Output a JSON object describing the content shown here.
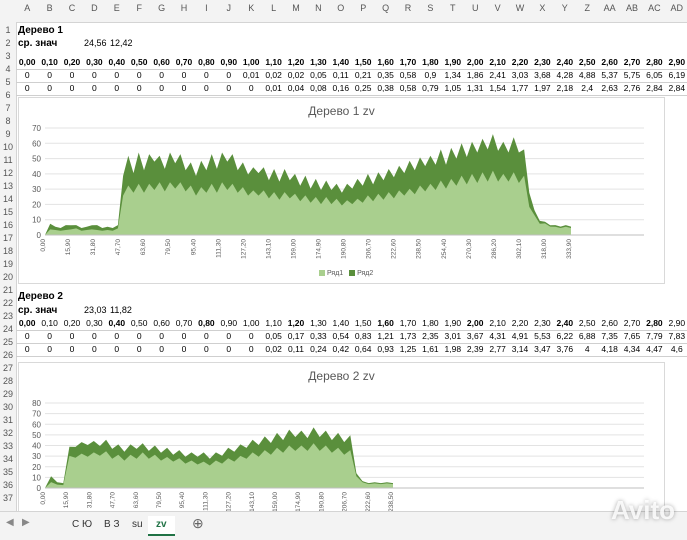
{
  "columns": [
    "A",
    "B",
    "C",
    "D",
    "E",
    "F",
    "G",
    "H",
    "I",
    "J",
    "K",
    "L",
    "M",
    "N",
    "O",
    "P",
    "Q",
    "R",
    "S",
    "T",
    "U",
    "V",
    "W",
    "X",
    "Y",
    "Z",
    "AA",
    "AB",
    "AC",
    "AD"
  ],
  "rows": [
    "1",
    "2",
    "3",
    "4",
    "5",
    "6",
    "7",
    "8",
    "9",
    "10",
    "11",
    "12",
    "13",
    "14",
    "15",
    "16",
    "17",
    "18",
    "19",
    "20",
    "21",
    "22",
    "23",
    "24",
    "25",
    "26",
    "27",
    "28",
    "29",
    "30",
    "31",
    "32",
    "33",
    "34",
    "35",
    "36",
    "37"
  ],
  "section1": {
    "title": "Дерево 1",
    "avg_label": "ср. знач",
    "avg1": "24,56",
    "avg2": "12,42",
    "row3": [
      "0,00",
      "0,10",
      "0,20",
      "0,30",
      "0,40",
      "0,50",
      "0,60",
      "0,70",
      "0,80",
      "0,90",
      "1,00",
      "1,10",
      "1,20",
      "1,30",
      "1,40",
      "1,50",
      "1,60",
      "1,70",
      "1,80",
      "1,90",
      "2,00",
      "2,10",
      "2,20",
      "2,30",
      "2,40",
      "2,50",
      "2,60",
      "2,70",
      "2,80",
      "2,90"
    ],
    "row4": [
      "0",
      "0",
      "0",
      "0",
      "0",
      "0",
      "0",
      "0",
      "0",
      "0",
      "0,01",
      "0,02",
      "0,02",
      "0,05",
      "0,11",
      "0,21",
      "0,35",
      "0,58",
      "0,9",
      "1,34",
      "1,86",
      "2,41",
      "3,03",
      "3,68",
      "4,28",
      "4,88",
      "5,37",
      "5,75",
      "6,05",
      "6,19"
    ],
    "row5": [
      "0",
      "0",
      "0",
      "0",
      "0",
      "0",
      "0",
      "0",
      "0",
      "0",
      "0",
      "0,01",
      "0,04",
      "0,08",
      "0,16",
      "0,25",
      "0,38",
      "0,58",
      "0,79",
      "1,05",
      "1,31",
      "1,54",
      "1,77",
      "1,97",
      "2,18",
      "2,4",
      "2,63",
      "2,76",
      "2,84",
      "2,84"
    ]
  },
  "section2": {
    "title": "Дерево 2",
    "avg_label": "ср. знач",
    "avg1": "23,03",
    "avg2": "11,82",
    "row23": [
      "0,00",
      "0,10",
      "0,20",
      "0,30",
      "0,40",
      "0,50",
      "0,60",
      "0,70",
      "0,80",
      "0,90",
      "1,00",
      "1,10",
      "1,20",
      "1,30",
      "1,40",
      "1,50",
      "1,60",
      "1,70",
      "1,80",
      "1,90",
      "2,00",
      "2,10",
      "2,20",
      "2,30",
      "2,40",
      "2,50",
      "2,60",
      "2,70",
      "2,80",
      "2,90"
    ],
    "row24": [
      "0",
      "0",
      "0",
      "0",
      "0",
      "0",
      "0",
      "0",
      "0",
      "0",
      "0",
      "0,05",
      "0,17",
      "0,33",
      "0,54",
      "0,83",
      "1,21",
      "1,73",
      "2,35",
      "3,01",
      "3,67",
      "4,31",
      "4,91",
      "5,53",
      "6,22",
      "6,88",
      "7,35",
      "7,65",
      "7,79",
      "7,83"
    ],
    "row25": [
      "0",
      "0",
      "0",
      "0",
      "0",
      "0",
      "0",
      "0",
      "0",
      "0",
      "0",
      "0,02",
      "0,11",
      "0,24",
      "0,42",
      "0,64",
      "0,93",
      "1,25",
      "1,61",
      "1,98",
      "2,39",
      "2,77",
      "3,14",
      "3,47",
      "3,76",
      "4",
      "4,18",
      "4,34",
      "4,47",
      "4,6"
    ]
  },
  "chart_data": [
    {
      "type": "area",
      "title": "Дерево 1 zv",
      "ylim": [
        0,
        70
      ],
      "yticks": [
        "70",
        "60",
        "50",
        "40",
        "30",
        "20",
        "10",
        "0"
      ],
      "xticks": [
        "0,00",
        "15,90",
        "31,80",
        "47,70",
        "63,60",
        "79,50",
        "95,40",
        "111,30",
        "127,20",
        "143,10",
        "159,00",
        "174,90",
        "190,80",
        "206,70",
        "222,60",
        "238,50",
        "254,40",
        "270,30",
        "286,20",
        "302,10",
        "318,00",
        "333,90"
      ],
      "x_start": 0,
      "x_end": 340,
      "legend": [
        "Ряд1",
        "Ряд2"
      ],
      "series": [
        {
          "name": "Ряд1",
          "color": "#a9cf8e",
          "values": [
            0,
            4,
            3,
            3,
            3,
            4,
            4,
            3,
            3,
            4,
            3,
            3,
            3,
            3,
            4,
            28,
            30,
            30,
            31,
            30,
            31,
            32,
            32,
            31,
            32,
            33,
            32,
            31,
            30,
            28,
            29,
            30,
            31,
            30,
            32,
            32,
            31,
            30,
            29,
            28,
            27,
            28,
            27,
            26,
            26,
            25,
            26,
            26,
            25,
            24,
            24,
            23,
            23,
            22,
            23,
            22,
            22,
            21,
            21,
            22,
            22,
            23,
            24,
            24,
            25,
            25,
            26,
            26,
            27,
            28,
            28,
            29,
            30,
            31,
            31,
            32,
            33,
            33,
            34,
            35,
            36,
            36,
            37,
            37,
            38,
            38,
            39,
            38,
            37,
            38,
            38,
            37,
            36,
            20,
            12,
            8,
            7,
            6,
            5,
            5,
            5,
            5
          ]
        },
        {
          "name": "Ryd2",
          "color": "#5a8f3c",
          "values": [
            0,
            8,
            5,
            5,
            6,
            7,
            6,
            5,
            5,
            7,
            6,
            5,
            5,
            5,
            6,
            42,
            48,
            44,
            50,
            46,
            49,
            52,
            48,
            47,
            50,
            51,
            49,
            46,
            44,
            42,
            45,
            46,
            49,
            47,
            50,
            52,
            49,
            46,
            44,
            43,
            41,
            44,
            41,
            39,
            40,
            38,
            40,
            39,
            37,
            35,
            36,
            33,
            34,
            32,
            33,
            32,
            31,
            30,
            31,
            33,
            34,
            35,
            37,
            36,
            38,
            39,
            40,
            41,
            42,
            44,
            45,
            46,
            47,
            49,
            48,
            50,
            52,
            50,
            53,
            54,
            56,
            55,
            57,
            58,
            59,
            60,
            62,
            59,
            57,
            58,
            60,
            58,
            52,
            30,
            15,
            10,
            8,
            7,
            6,
            6,
            6,
            6
          ]
        }
      ]
    },
    {
      "type": "area",
      "title": "Дерево 2 zv",
      "ylim": [
        0,
        80
      ],
      "yticks": [
        "80",
        "70",
        "60",
        "50",
        "40",
        "30",
        "20",
        "10",
        "0"
      ],
      "xticks": [
        "0,00",
        "15,90",
        "31,80",
        "47,70",
        "63,60",
        "79,50",
        "95,40",
        "111,30",
        "127,20",
        "143,10",
        "159,00",
        "174,90",
        "190,80",
        "206,70",
        "222,60",
        "238,50"
      ],
      "x_start": 0,
      "x_end": 240,
      "legend": [],
      "series": [
        {
          "name": "Ряд1",
          "color": "#a9cf8e",
          "values": [
            0,
            6,
            3,
            3,
            28,
            31,
            30,
            32,
            31,
            33,
            32,
            30,
            29,
            28,
            29,
            30,
            31,
            30,
            29,
            28,
            27,
            27,
            26,
            25,
            24,
            24,
            23,
            23,
            24,
            25,
            26,
            27,
            28,
            30,
            31,
            32,
            33,
            34,
            35,
            36,
            37,
            38,
            37,
            38,
            39,
            38,
            37,
            36,
            35,
            34,
            33,
            12,
            5,
            4,
            4,
            4,
            4,
            4
          ]
        },
        {
          "name": "Ryd2",
          "color": "#5a8f3c",
          "values": [
            0,
            12,
            5,
            5,
            36,
            42,
            40,
            44,
            41,
            43,
            42,
            40,
            38,
            37,
            38,
            40,
            39,
            38,
            37,
            36,
            35,
            34,
            33,
            32,
            31,
            32,
            31,
            30,
            31,
            33,
            35,
            37,
            38,
            41,
            42,
            44,
            45,
            46,
            48,
            49,
            51,
            52,
            50,
            51,
            53,
            52,
            50,
            49,
            48,
            47,
            46,
            15,
            6,
            5,
            5,
            5,
            5,
            5
          ]
        }
      ]
    }
  ],
  "tabs": [
    "С Ю",
    "В З",
    "su",
    "zv"
  ],
  "active_tab": "zv",
  "watermark": "Avito"
}
